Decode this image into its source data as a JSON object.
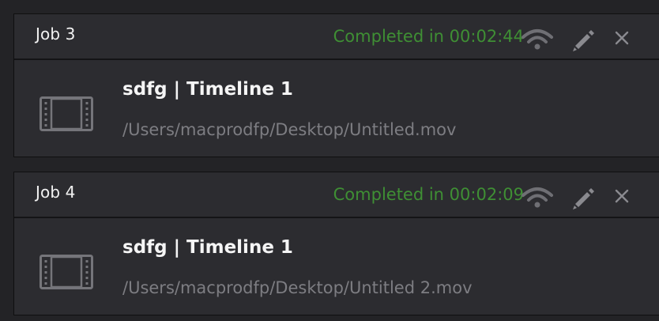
{
  "jobs": [
    {
      "title": "Job 3",
      "status": "Completed in 00:02:44",
      "clip_name": "sdfg | Timeline 1",
      "path": "/Users/macprodfp/Desktop/Untitled.mov"
    },
    {
      "title": "Job 4",
      "status": "Completed in 00:02:09",
      "clip_name": "sdfg | Timeline 1",
      "path": "/Users/macprodfp/Desktop/Untitled 2.mov"
    }
  ],
  "icons": {
    "remote": "wifi-icon",
    "edit": "pencil-icon",
    "remove": "close-icon",
    "thumbnail": "film-strip-icon"
  },
  "colors": {
    "background": "#232326",
    "card": "#2c2c30",
    "status_completed": "#3f8f34",
    "title_text": "#f2f2f2",
    "path_text": "#7d7d82",
    "icon_gray": "#8a8a8f"
  }
}
